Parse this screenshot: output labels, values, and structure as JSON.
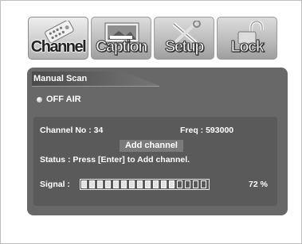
{
  "tabs": [
    {
      "label": "Channel",
      "icon": "remote-icon",
      "active": true
    },
    {
      "label": "Caption",
      "icon": "caption-icon",
      "active": false
    },
    {
      "label": "Setup",
      "icon": "tools-icon",
      "active": false
    },
    {
      "label": "Lock",
      "icon": "padlock-icon",
      "active": false
    }
  ],
  "panel": {
    "title": "Manual Scan",
    "mode": "OFF AIR",
    "channel_no": "Channel No : 34",
    "freq": "Freq : 593000",
    "add_button": "Add channel",
    "status": "Status : Press [Enter] to Add channel.",
    "signal_label": "Signal :",
    "signal_percent_text": "72 %",
    "signal_level": 0.72,
    "signal_segments": 16
  },
  "colors": {
    "panel": "#686868",
    "inner": "#5a5a5a",
    "text": "#ffffff"
  }
}
